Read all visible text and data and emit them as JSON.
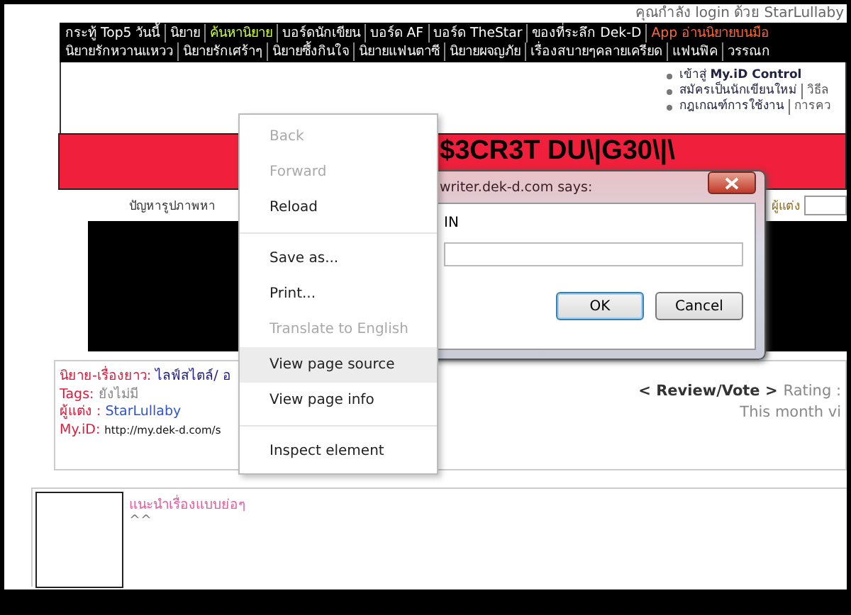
{
  "login_note": "คุณกำลัง login ด้วย StarLullaby",
  "nav_rows": [
    [
      {
        "label": "กระทู้ Top5 วันนี้",
        "color": "#ffffff"
      },
      {
        "label": "นิยาย",
        "color": "#ffffff"
      },
      {
        "label": "ค้นหานิยาย",
        "color": "#ccff33"
      },
      {
        "label": "บอร์ดนักเขียน",
        "color": "#ffffff"
      },
      {
        "label": "บอร์ด AF",
        "color": "#ffffff"
      },
      {
        "label": "บอร์ด TheStar",
        "color": "#ffffff"
      },
      {
        "label": "ของที่ระลึก Dek-D",
        "color": "#ffffff"
      },
      {
        "label": "App อ่านนิยายบนมือ",
        "color": "#ff6633"
      }
    ],
    [
      {
        "label": "นิยายรักหวานแหวว",
        "color": "#ffffff"
      },
      {
        "label": "นิยายรักเศร้าๆ",
        "color": "#ffffff"
      },
      {
        "label": "นิยายซึ้งกินใจ",
        "color": "#ffffff"
      },
      {
        "label": "นิยายแฟนตาซี",
        "color": "#ffffff"
      },
      {
        "label": "นิยายผจญภัย",
        "color": "#ffffff"
      },
      {
        "label": "เรื่องสบายๆคลายเครียด",
        "color": "#ffffff"
      },
      {
        "label": "แฟนฟิค",
        "color": "#ffffff"
      },
      {
        "label": "วรรณก",
        "color": "#ffffff"
      }
    ]
  ],
  "account_links": [
    [
      "เข้าสู่ **My.iD Control**"
    ],
    [
      "สมัครเป็นนักเขียนใหม่",
      "วิธีล"
    ],
    [
      "กฎเกณฑ์การใช้งาน",
      "การคว"
    ]
  ],
  "banner_title": "$3CR3T DU\\|G30\\|\\",
  "problem_note": "ปัญหารูปภาพหา",
  "author_search": {
    "label": "ผู้แต่ง"
  },
  "info": [
    {
      "label": "นิยาย-เรื่องยาว:",
      "value": "ไลฟ์สไตล์/ อ",
      "kind": "category"
    },
    {
      "label": "Tags:",
      "value": "ยังไม่มี",
      "kind": "plain"
    },
    {
      "label": "ผู้แต่ง :",
      "value": "StarLullaby",
      "kind": "link"
    },
    {
      "label": "My.iD:",
      "value": "http://my.dek-d.com/s",
      "kind": "url"
    }
  ],
  "review": {
    "title": "< Review/Vote >",
    "rating": "Rating :",
    "month": "This month vi"
  },
  "recommend": {
    "title": "แนะนำเรื่องแบบย่อๆ",
    "text": "^^"
  },
  "context_menu": [
    {
      "kind": "item",
      "label": "Back",
      "disabled": true,
      "selected": false
    },
    {
      "kind": "item",
      "label": "Forward",
      "disabled": true,
      "selected": false
    },
    {
      "kind": "item",
      "label": "Reload",
      "disabled": false,
      "selected": false
    },
    {
      "kind": "separator"
    },
    {
      "kind": "item",
      "label": "Save as...",
      "disabled": false,
      "selected": false
    },
    {
      "kind": "item",
      "label": "Print...",
      "disabled": false,
      "selected": false
    },
    {
      "kind": "item",
      "label": "Translate to English",
      "disabled": true,
      "selected": false
    },
    {
      "kind": "item",
      "label": "View page source",
      "disabled": false,
      "selected": true
    },
    {
      "kind": "item",
      "label": "View page info",
      "disabled": false,
      "selected": false
    },
    {
      "kind": "separator"
    },
    {
      "kind": "item",
      "label": "Inspect element",
      "disabled": false,
      "selected": false
    }
  ],
  "dialog": {
    "title": "writer.dek-d.com says:",
    "message": "IN",
    "buttons": [
      {
        "label": "OK",
        "selected": true
      },
      {
        "label": "Cancel",
        "selected": false
      }
    ]
  }
}
